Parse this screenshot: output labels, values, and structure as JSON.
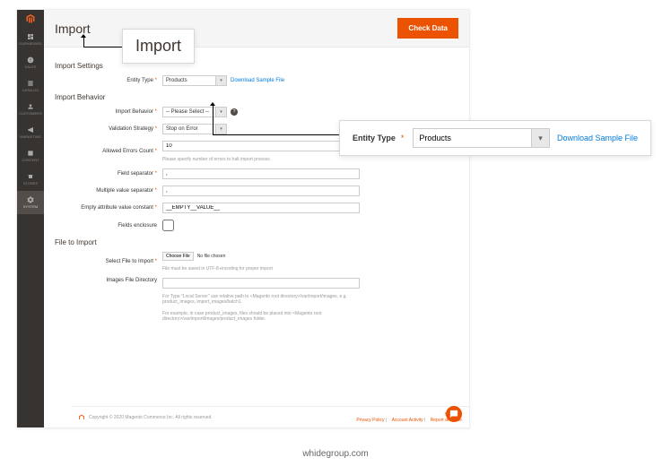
{
  "sidebar": {
    "items": [
      "DASHBOARD",
      "SALES",
      "CATALOG",
      "CUSTOMERS",
      "MARKETING",
      "CONTENT",
      "STORES",
      "SYSTEM"
    ]
  },
  "header": {
    "title": "Import",
    "check_btn": "Check Data"
  },
  "sections": {
    "settings": "Import Settings",
    "behavior": "Import Behavior",
    "file": "File to Import"
  },
  "labels": {
    "entity_type": "Entity Type",
    "import_behavior": "Import Behavior",
    "validation": "Validation Strategy",
    "errors": "Allowed Errors Count",
    "field_sep": "Field separator",
    "multi_sep": "Multiple value separator",
    "empty_const": "Empty attribute value constant",
    "enclosure": "Fields enclosure",
    "select_file": "Select File to Import",
    "img_dir": "Images File Directory"
  },
  "values": {
    "entity_type": "Products",
    "behavior": "-- Please Select --",
    "validation": "Stop on Error",
    "errors": "10",
    "field_sep": ",",
    "multi_sep": ",",
    "empty_const": "__EMPTY__VALUE__",
    "no_file": "No file chosen",
    "choose": "Choose File"
  },
  "hints": {
    "errors": "Please specify number of errors to halt import process",
    "file": "File must be saved in UTF-8 encoding for proper import",
    "dir1": "For Type \"Local Server\" use relative path to <Magento root directory>/var/import/images, e.g. product_images, import_images/batch1.",
    "dir2": "For example, in case product_images, files should be placed into <Magento root directory>/var/import/images/product_images folder."
  },
  "links": {
    "download": "Download Sample File"
  },
  "footer": {
    "copyright": "Copyright © 2020 Magento Commerce Inc. All rights reserved.",
    "magento": "Magento",
    "privacy": "Privacy Policy",
    "account": "Account Activity",
    "report": "Report an Issue"
  },
  "callout": {
    "title": "Import",
    "entity_label": "Entity Type",
    "entity_value": "Products",
    "download": "Download Sample File"
  },
  "watermark": "whidegroup.com"
}
